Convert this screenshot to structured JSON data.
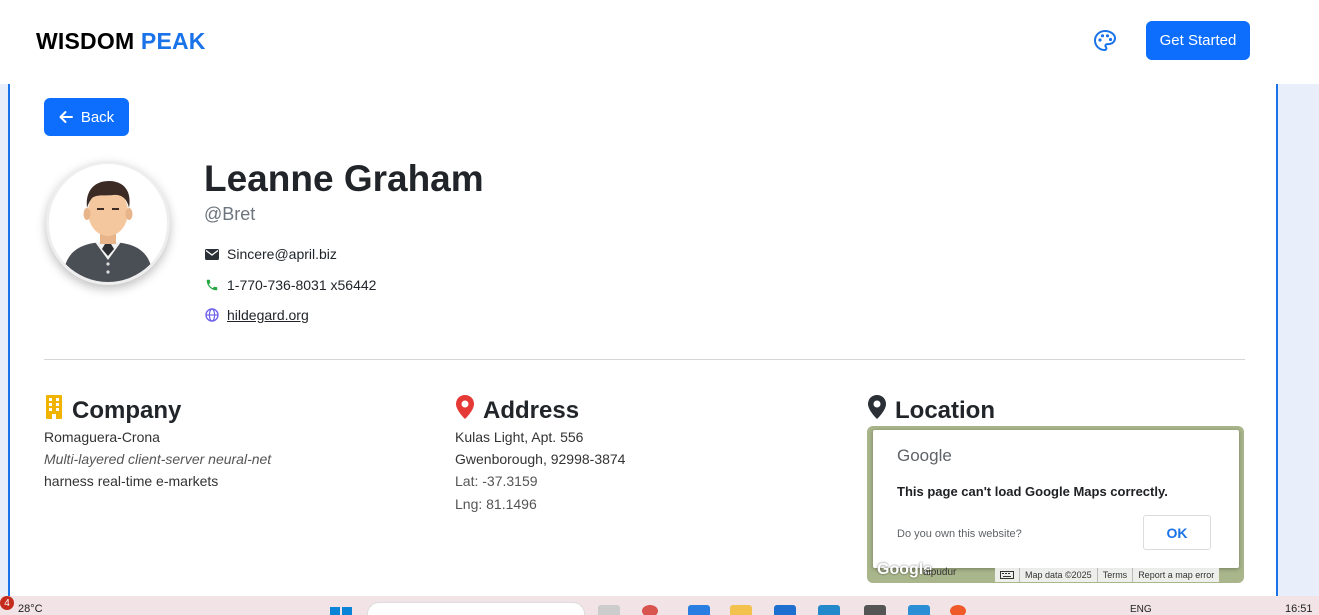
{
  "header": {
    "brand_part1": "WISDOM",
    "brand_part2": "PEAK",
    "theme_icon": "palette-icon",
    "cta_label": "Get Started"
  },
  "back": {
    "label": "Back",
    "icon": "arrow-left-icon"
  },
  "profile": {
    "avatar_icon": "user-avatar-illustration",
    "name": "Leanne Graham",
    "handle": "@Bret",
    "email": "Sincere@april.biz",
    "phone": "1-770-736-8031 x56442",
    "website": "hildegard.org"
  },
  "company": {
    "title": "Company",
    "icon": "building-icon",
    "name": "Romaguera-Crona",
    "catchphrase": "Multi-layered client-server neural-net",
    "bs": "harness real-time e-markets"
  },
  "address": {
    "title": "Address",
    "icon": "map-pin-icon",
    "street": "Kulas Light, Apt. 556",
    "city_zip": "Gwenborough, 92998-3874",
    "lat": "Lat: -37.3159",
    "lng": "Lng: 81.1496"
  },
  "location": {
    "title": "Location",
    "icon": "location-marker-icon",
    "map": {
      "google_logo": "Google",
      "message": "This page can't load Google Maps correctly.",
      "question": "Do you own this website?",
      "ok_label": "OK",
      "watermark": "Google",
      "place": "aipudur",
      "footer_data": "Map data ©2025",
      "footer_terms": "Terms",
      "footer_report": "Report a map error"
    }
  },
  "taskbar": {
    "badge": "4",
    "temperature": "28°C",
    "language": "ENG",
    "time": "16:51"
  },
  "colors": {
    "primary": "#0d6efd",
    "brand_blue": "#1a73e8",
    "building_icon": "#f0b400",
    "pin_icon": "#e53935",
    "phone_icon": "#28a745",
    "globe_icon": "#6f63e6"
  }
}
